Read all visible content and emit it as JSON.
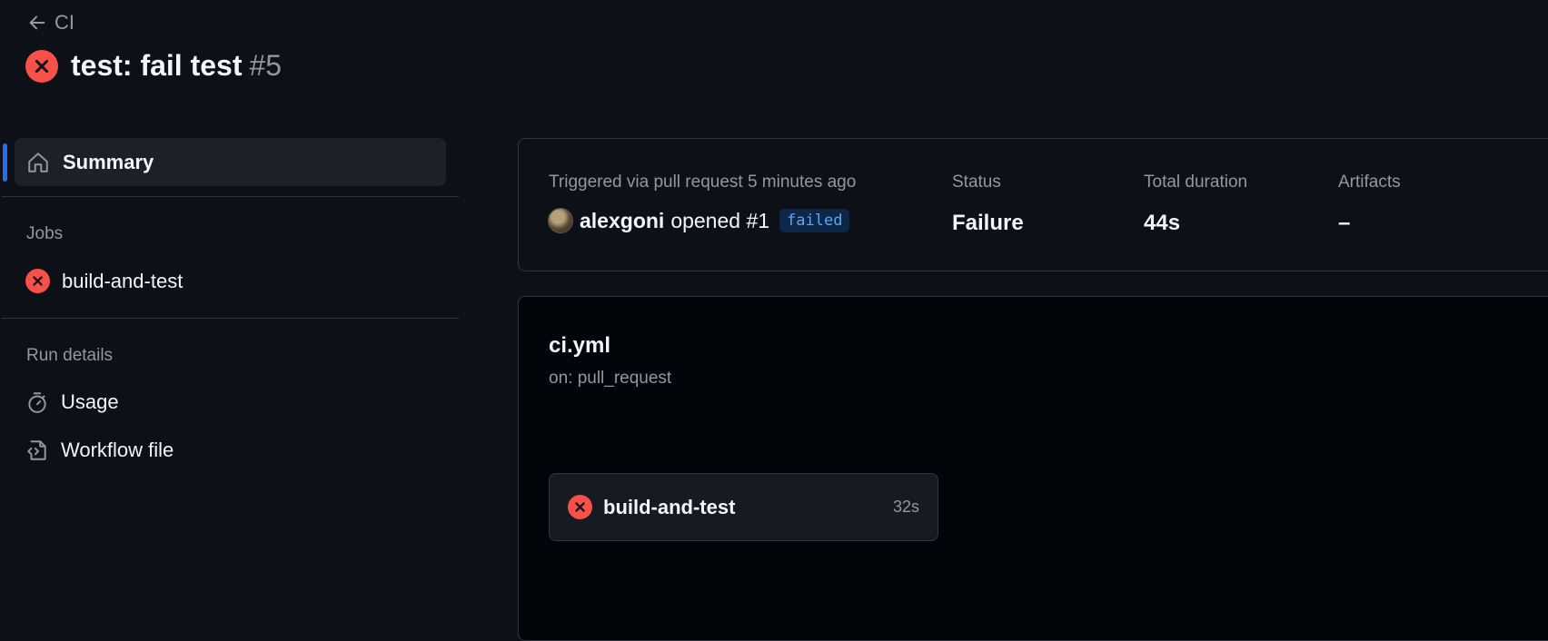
{
  "header": {
    "back_label": "CI",
    "title": "test: fail test",
    "run_number": "#5"
  },
  "sidebar": {
    "summary_label": "Summary",
    "jobs_heading": "Jobs",
    "jobs": [
      {
        "label": "build-and-test",
        "status": "failure"
      }
    ],
    "run_details_heading": "Run details",
    "usage_label": "Usage",
    "workflow_file_label": "Workflow file"
  },
  "summary": {
    "trigger_text": "Triggered via pull request 5 minutes ago",
    "actor": "alexgoni",
    "action_text": "opened #1",
    "badge": "failed",
    "status_label": "Status",
    "status_value": "Failure",
    "duration_label": "Total duration",
    "duration_value": "44s",
    "artifacts_label": "Artifacts",
    "artifacts_value": "–"
  },
  "workflow": {
    "file_name": "ci.yml",
    "trigger": "on: pull_request",
    "jobs": [
      {
        "name": "build-and-test",
        "duration": "32s",
        "status": "failure"
      }
    ]
  },
  "colors": {
    "background": "#0d1117",
    "failure": "#f85149",
    "accent": "#1f6feb",
    "badge_text": "#58a6ff"
  },
  "icons": [
    "arrow-left-icon",
    "x-circle-icon",
    "home-icon",
    "stopwatch-icon",
    "file-code-icon"
  ]
}
